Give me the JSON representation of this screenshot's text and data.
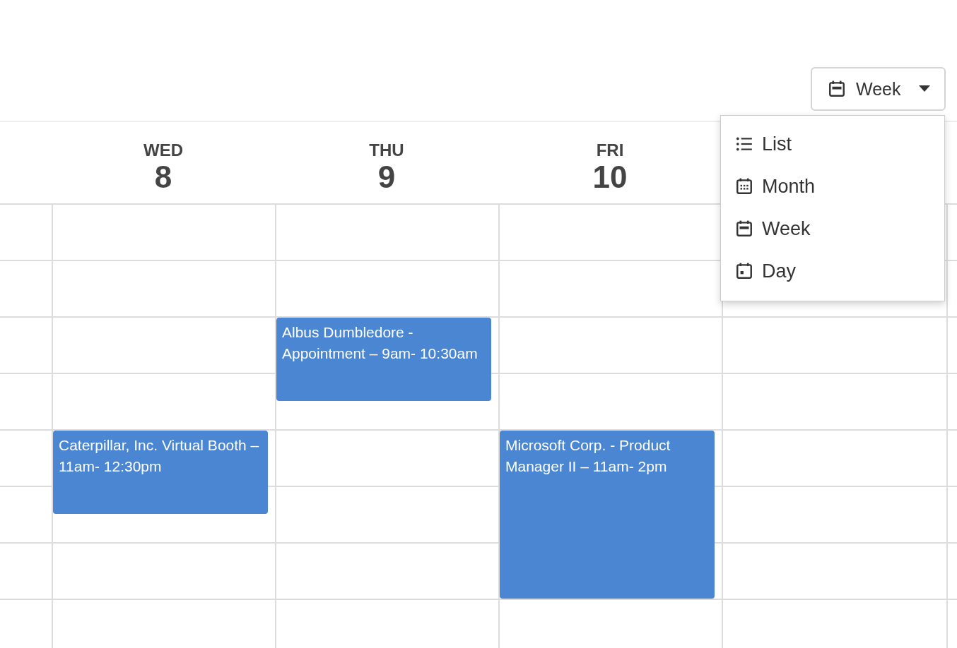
{
  "view_button": {
    "label": "Week"
  },
  "days": [
    {
      "weekday": "WED",
      "date": "8",
      "events": [
        {
          "title": "Caterpillar, Inc. Virtual Booth – 11am- 12:30pm"
        }
      ]
    },
    {
      "weekday": "THU",
      "date": "9",
      "events": [
        {
          "title": "Albus Dumbledore - Appointment – 9am- 10:30am"
        }
      ]
    },
    {
      "weekday": "FRI",
      "date": "10",
      "events": [
        {
          "title": "Microsoft Corp. - Product Manager II – 11am- 2pm"
        }
      ]
    }
  ],
  "view_menu": [
    {
      "kind": "list",
      "label": "List"
    },
    {
      "kind": "month",
      "label": "Month"
    },
    {
      "kind": "week",
      "label": "Week"
    },
    {
      "kind": "day",
      "label": "Day"
    }
  ]
}
